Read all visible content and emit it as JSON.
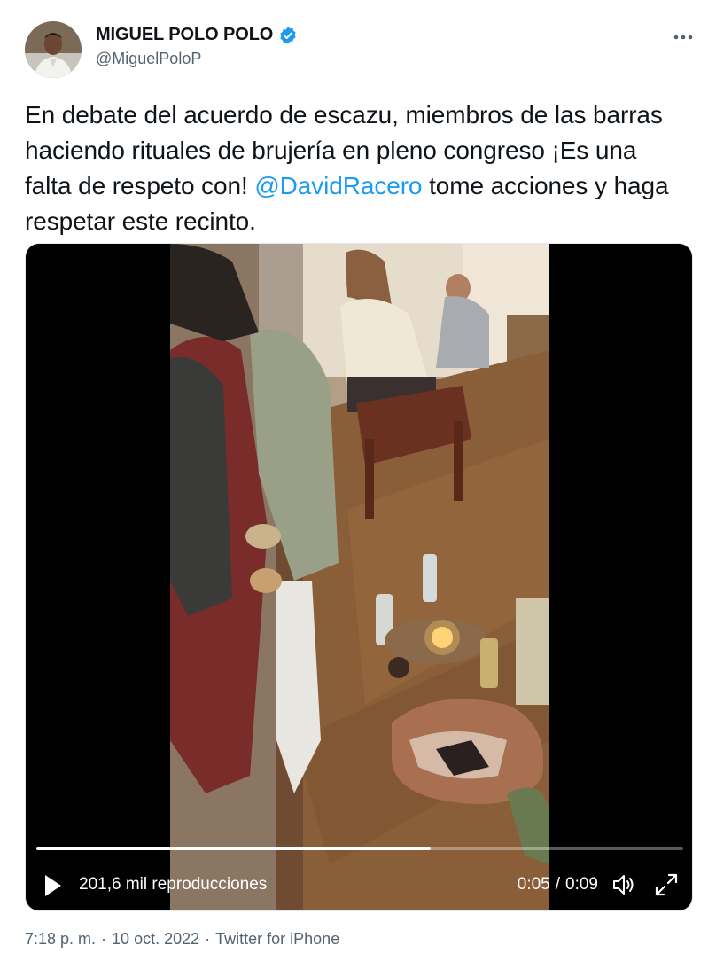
{
  "author": {
    "display_name": "MIGUEL POLO POLO",
    "handle": "@MiguelPoloP",
    "verified": true,
    "verified_color": "#1d9bf0"
  },
  "tweet": {
    "text_before_mention": "En debate del acuerdo de escazu, miembros de las barras haciendo rituales de brujería en pleno congreso ¡Es una falta de respeto con! ",
    "mention": "@DavidRacero",
    "text_after_mention": " tome acciones y haga respetar este recinto."
  },
  "video": {
    "views": "201,6 mil reproducciones",
    "current_time": "0:05",
    "separator": "/",
    "duration": "0:09",
    "progress": 0.61
  },
  "meta": {
    "time": "7:18 p. m.",
    "dot1": "·",
    "date": "10 oct. 2022",
    "dot2": "·",
    "source": "Twitter for iPhone"
  },
  "icons": {
    "more": "more-horizontal-icon",
    "verified": "verified-badge-icon",
    "play": "play-icon",
    "volume": "volume-muted-icon",
    "fullscreen": "fullscreen-icon"
  },
  "colors": {
    "link": "#1d9bf0",
    "secondary_text": "#536471",
    "primary_text": "#0f1419"
  }
}
